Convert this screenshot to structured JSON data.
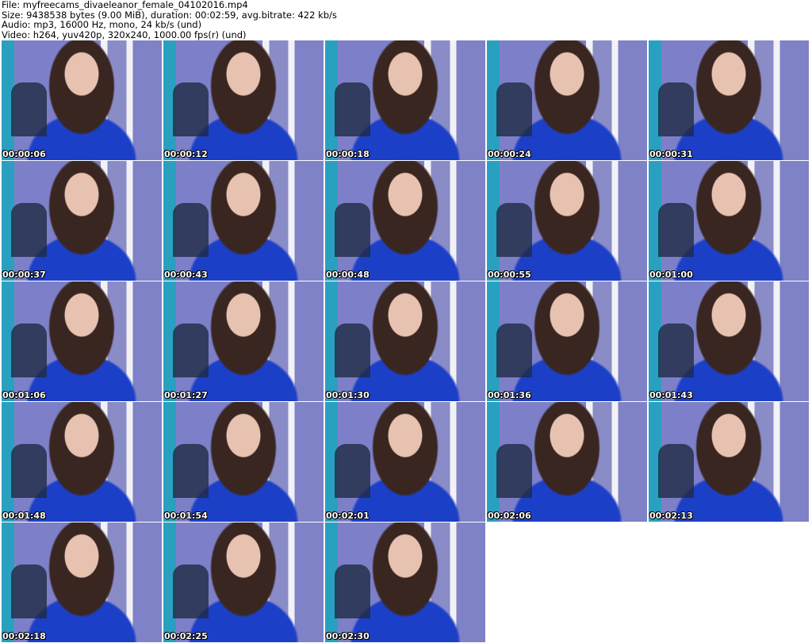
{
  "info": {
    "file": "File: myfreecams_divaeleanor_female_04102016.mp4",
    "size": "Size: 9438538 bytes (9.00 MiB), duration: 00:02:59, avg.bitrate: 422 kb/s",
    "audio": "Audio: mp3, 16000 Hz, mono, 24 kb/s (und)",
    "video": "Video: h264, yuv420p, 320x240, 1000.00 fps(r) (und)"
  },
  "thumbnails": [
    "00:00:06",
    "00:00:12",
    "00:00:18",
    "00:00:24",
    "00:00:31",
    "00:00:37",
    "00:00:43",
    "00:00:48",
    "00:00:55",
    "00:01:00",
    "00:01:06",
    "00:01:27",
    "00:01:30",
    "00:01:36",
    "00:01:43",
    "00:01:48",
    "00:01:54",
    "00:02:01",
    "00:02:06",
    "00:02:13",
    "00:02:18",
    "00:02:25",
    "00:02:30"
  ]
}
